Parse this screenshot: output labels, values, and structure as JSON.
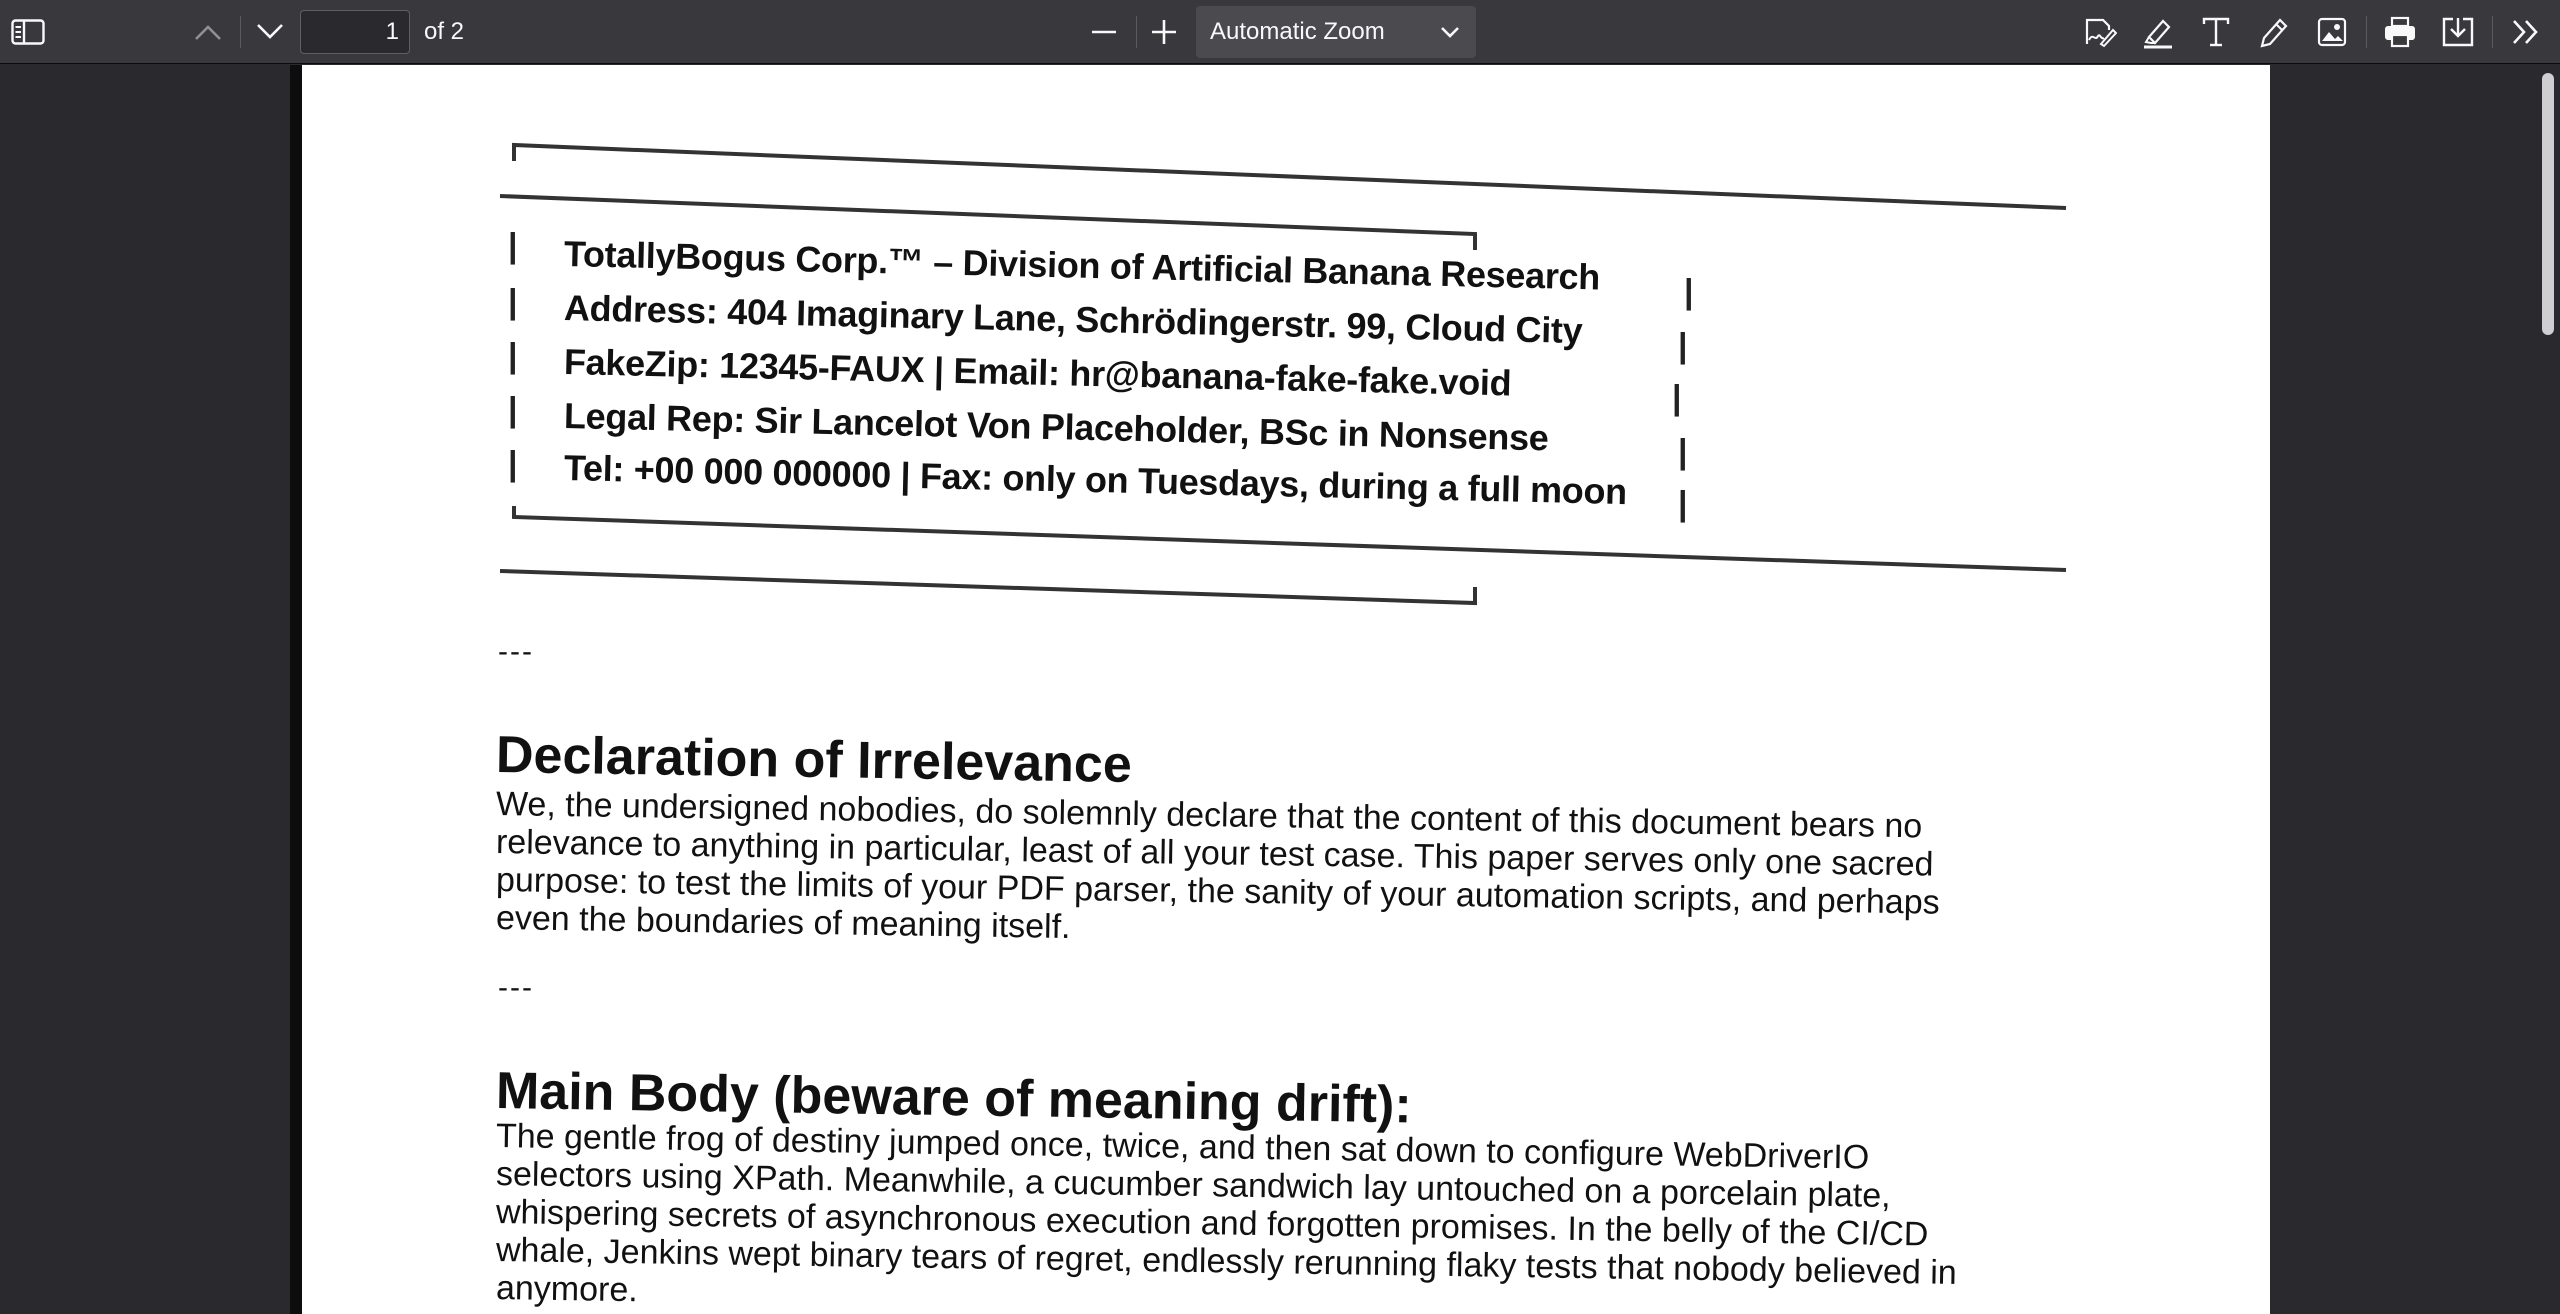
{
  "toolbar": {
    "page_number": "1",
    "page_count": "of 2",
    "zoom": "Automatic Zoom",
    "icons": [
      "sidebar-toggle-icon",
      "chevron-up-icon",
      "chevron-down-icon",
      "zoom-out-icon",
      "zoom-in-icon",
      "chevron-down-icon",
      "signature-icon",
      "highlight-icon",
      "text-icon",
      "draw-icon",
      "image-icon",
      "print-icon",
      "download-icon",
      "double-chevron-right-icon"
    ]
  },
  "document": {
    "letterhead": [
      "TotallyBogus Corp.™ – Division of Artificial Banana Research",
      "Address: 404 Imaginary Lane, Schrödingerstr. 99, Cloud City",
      "FakeZip: 12345-FAUX | Email: hr@banana-fake-fake.void",
      "Legal Rep: Sir Lancelot Von Placeholder, BSc in Nonsense",
      "Tel: +00 000 000000 | Fax: only on Tuesdays, during a full moon"
    ],
    "separator_1": "---",
    "declaration": {
      "title": "Declaration of Irrelevance",
      "lines": [
        "We, the undersigned nobodies, do solemnly declare that the content of this document bears no",
        "relevance to anything in particular, least of all your test case. This paper serves only one sacred",
        "purpose: to test the limits of your PDF parser, the sanity of your automation scripts, and perhaps",
        "even the boundaries of meaning itself."
      ]
    },
    "separator_2": "---",
    "main_body": {
      "title": "Main Body (beware of meaning drift):",
      "lines": [
        "The gentle frog of destiny jumped once, twice, and then sat down to configure WebDriverIO",
        "selectors using XPath. Meanwhile, a cucumber sandwich lay untouched on a porcelain plate,",
        "whispering secrets of asynchronous execution and forgotten promises. In the belly of the CI/CD",
        "whale, Jenkins wept binary tears of regret, endlessly rerunning flaky tests that nobody believed in",
        "anymore."
      ]
    }
  }
}
